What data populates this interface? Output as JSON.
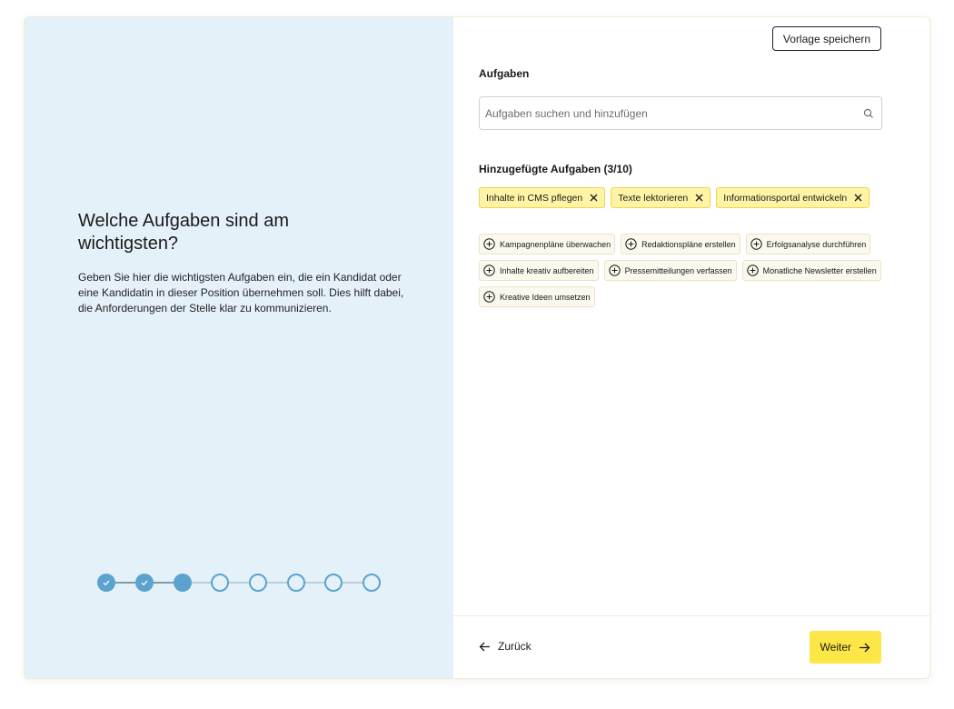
{
  "left": {
    "title": "Welche Aufgaben sind am wichtigsten?",
    "description": "Geben Sie hier die wichtigsten Aufgaben ein, die ein Kandidat oder eine Kandidatin in dieser Position übernehmen soll. Dies hilft dabei, die Anforderungen der Stelle klar zu kommunizieren.",
    "stepper": {
      "total": 8,
      "completed": 2,
      "current": 3
    }
  },
  "right": {
    "save_template_label": "Vorlage speichern",
    "tasks_label": "Aufgaben",
    "search": {
      "placeholder": "Aufgaben suchen und hinzufügen",
      "value": ""
    },
    "added_label": "Hinzugefügte Aufgaben (3/10)",
    "added": [
      "Inhalte in CMS pflegen",
      "Texte lektorieren",
      "Informationsportal entwickeln"
    ],
    "suggestions": [
      "Kampagnenpläne überwachen",
      "Redaktionspläne erstellen",
      "Erfolgsanalyse durchführen",
      "Inhalte kreativ aufbereiten",
      "Pressemitteilungen verfassen",
      "Monatliche Newsletter erstellen",
      "Kreative Ideen umsetzen"
    ],
    "back_label": "Zurück",
    "next_label": "Weiter"
  },
  "colors": {
    "left_panel_bg": "#e5f1f9",
    "step_accent": "#5ba3cf",
    "chip_bg": "#fff3a6",
    "primary_button": "#fde748"
  },
  "icons": {
    "search": "search-icon",
    "remove": "close-icon",
    "add": "plus-circle-icon",
    "back": "arrow-left-icon",
    "next": "arrow-right-icon",
    "step_done": "check-icon"
  }
}
